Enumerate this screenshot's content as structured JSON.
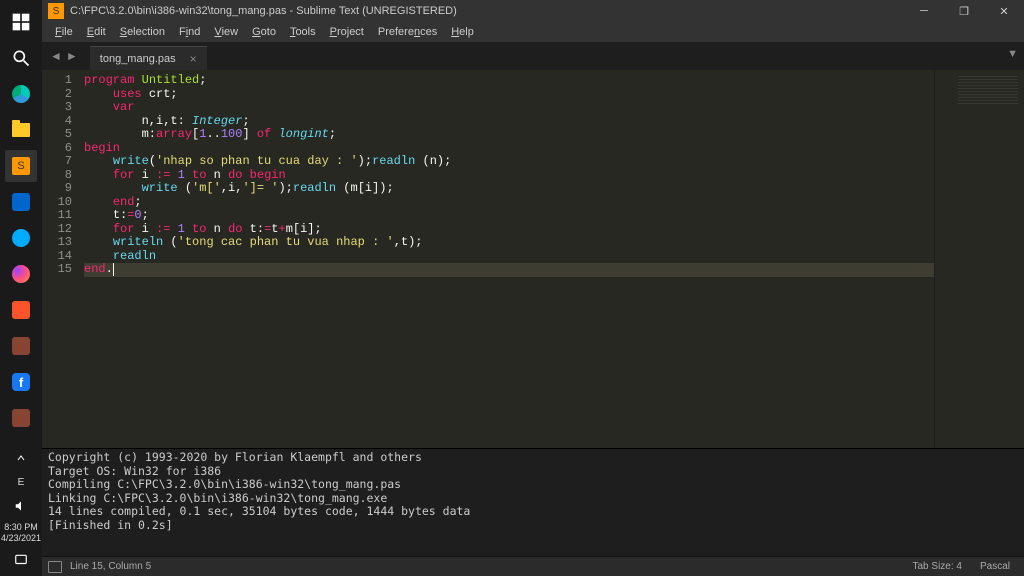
{
  "taskbar": {
    "clock_time": "8:30 PM",
    "clock_date": "4/23/2021"
  },
  "titlebar": {
    "path": "C:\\FPC\\3.2.0\\bin\\i386-win32\\tong_mang.pas - Sublime Text (UNREGISTERED)"
  },
  "menu": [
    "File",
    "Edit",
    "Selection",
    "Find",
    "View",
    "Goto",
    "Tools",
    "Project",
    "Preferences",
    "Help"
  ],
  "tab": {
    "label": "tong_mang.pas"
  },
  "code": {
    "lines": 15
  },
  "code_text": {
    "l1_kw": "program",
    "l1_name": " Untitled",
    "l1_end": ";",
    "l2_ind": "    ",
    "l2_kw": "uses",
    "l2_body": " crt;",
    "l3_ind": "    ",
    "l3_kw": "var",
    "l4_ind": "        ",
    "l4_body1": "n,i,t: ",
    "l4_type": "Integer",
    "l4_body2": ";",
    "l5_ind": "        ",
    "l5_body1": "m:",
    "l5_kw": "array",
    "l5_body2": "[",
    "l5_n1": "1",
    "l5_body3": "..",
    "l5_n2": "100",
    "l5_body4": "] ",
    "l5_kw2": "of",
    "l5_body5": " ",
    "l5_type": "longint",
    "l5_body6": ";",
    "l6_kw": "begin",
    "l7_ind": "    ",
    "l7_fn": "write",
    "l7_b1": "(",
    "l7_str": "'nhap so phan tu cua day : '",
    "l7_b2": ");",
    "l7_fn2": "readln",
    "l7_b3": " (n);",
    "l8_ind": "    ",
    "l8_kw": "for",
    "l8_b1": " i ",
    "l8_op": ":=",
    "l8_b2": " ",
    "l8_n": "1",
    "l8_b3": " ",
    "l8_kw2": "to",
    "l8_b4": " n ",
    "l8_kw3": "do",
    "l8_b5": " ",
    "l8_kw4": "begin",
    "l9_ind": "        ",
    "l9_fn": "write",
    "l9_b1": " (",
    "l9_s1": "'m['",
    "l9_b2": ",i,",
    "l9_s2": "']= '",
    "l9_b3": ");",
    "l9_fn2": "readln",
    "l9_b4": " (m[i]);",
    "l10_ind": "    ",
    "l10_kw": "end",
    "l10_b": ";",
    "l11_ind": "    ",
    "l11_b1": "t:",
    "l11_op": "=",
    "l11_n": "0",
    "l11_b2": ";",
    "l12_ind": "    ",
    "l12_kw": "for",
    "l12_b1": " i ",
    "l12_op": ":=",
    "l12_b2": " ",
    "l12_n": "1",
    "l12_b3": " ",
    "l12_kw2": "to",
    "l12_b4": " n ",
    "l12_kw3": "do",
    "l12_b5": " t:",
    "l12_op2": "=",
    "l12_b6": "t",
    "l12_op3": "+",
    "l12_b7": "m[i];",
    "l13_ind": "    ",
    "l13_fn": "writeln",
    "l13_b1": " (",
    "l13_s": "'tong cac phan tu vua nhap : '",
    "l13_b2": ",t);",
    "l14_ind": "    ",
    "l14_fn": "readln",
    "l15_kw": "end",
    "l15_b": "."
  },
  "console": {
    "l1": "Copyright (c) 1993-2020 by Florian Klaempfl and others",
    "l2": "Target OS: Win32 for i386",
    "l3": "Compiling C:\\FPC\\3.2.0\\bin\\i386-win32\\tong_mang.pas",
    "l4": "Linking C:\\FPC\\3.2.0\\bin\\i386-win32\\tong_mang.exe",
    "l5": "14 lines compiled, 0.1 sec, 35104 bytes code, 1444 bytes data",
    "l6": "[Finished in 0.2s]"
  },
  "status": {
    "pos": "Line 15, Column 5",
    "tab_size": "Tab Size: 4",
    "syntax": "Pascal"
  }
}
